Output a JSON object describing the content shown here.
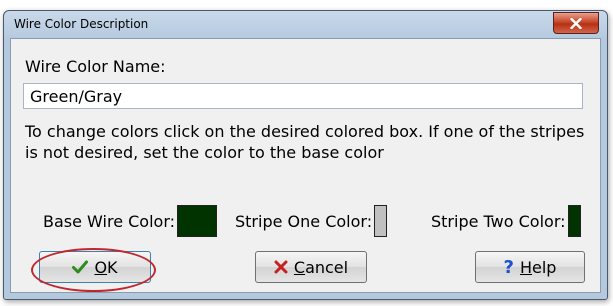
{
  "window": {
    "title": "Wire Color Description"
  },
  "form": {
    "name_label": "Wire Color Name:",
    "name_value": "Green/Gray",
    "instructions": "To change colors click on the desired colored box.  If one of the stripes is not desired, set the color to the base color"
  },
  "colors": {
    "base_label": "Base Wire Color:",
    "base_color": "#003300",
    "stripe_one_label": "Stripe One Color:",
    "stripe_one_color": "#c0c0c0",
    "stripe_two_label": "Stripe Two Color:",
    "stripe_two_color": "#003300"
  },
  "buttons": {
    "ok_label": "OK",
    "cancel_label": "Cancel",
    "help_label": "Help"
  },
  "icons": {
    "ok": "check-icon",
    "cancel": "x-icon",
    "help": "question-icon",
    "close": "close-icon"
  }
}
